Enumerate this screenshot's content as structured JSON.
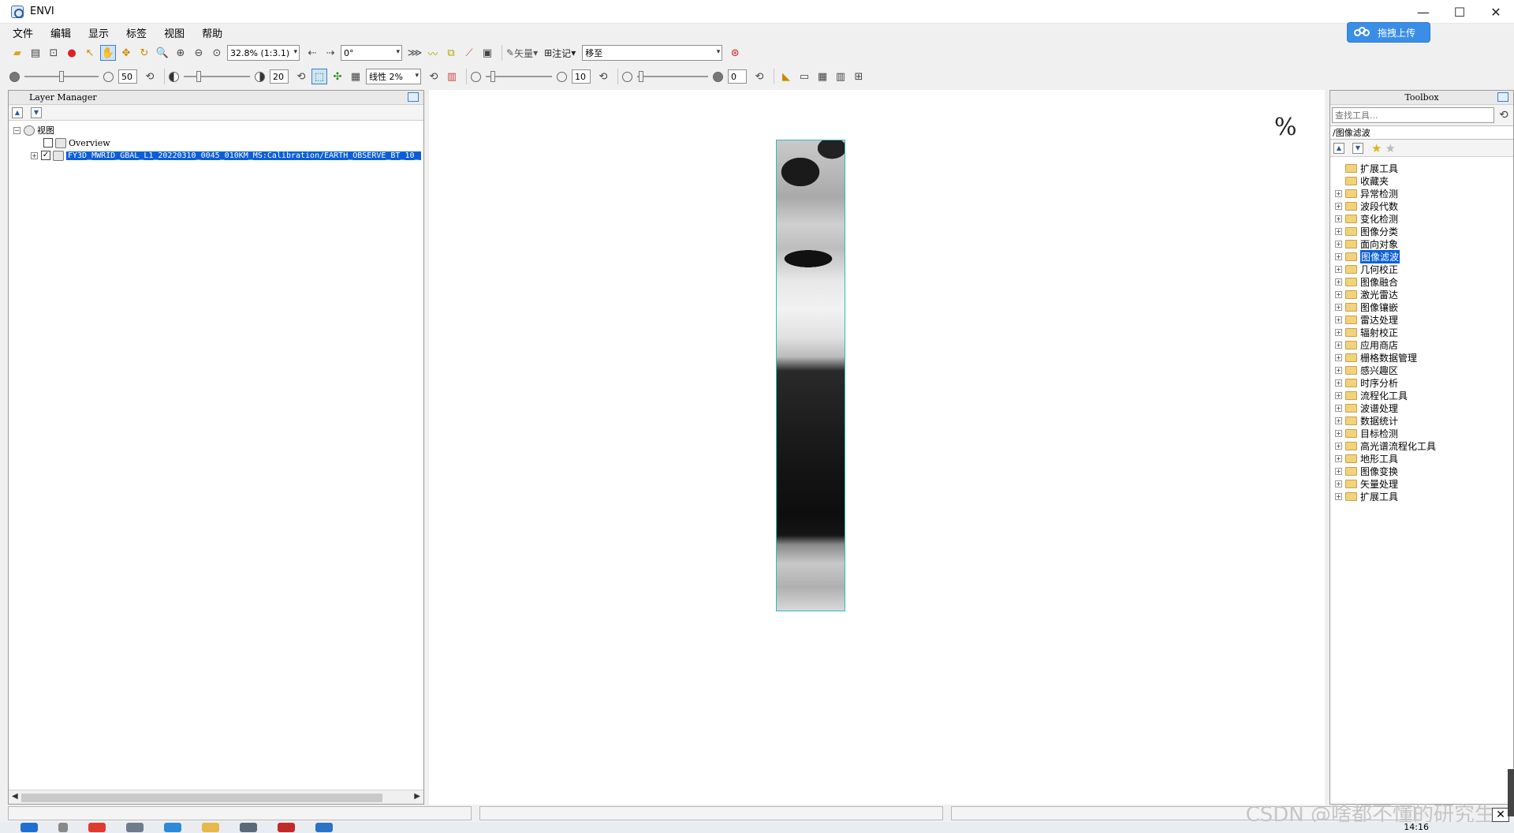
{
  "window": {
    "title": "ENVI",
    "minimize": "—",
    "maximize": "☐",
    "close": "✕"
  },
  "upload_button": {
    "label": "拖拽上传"
  },
  "menu": [
    "文件",
    "编辑",
    "显示",
    "标签",
    "视图",
    "帮助"
  ],
  "toolbar1": {
    "zoom_value": "32.8% (1:3.1)",
    "rotation_value": "0°",
    "vector_label": "矢量",
    "annotation_label": "注记",
    "goto_value": "移至"
  },
  "toolbar2": {
    "brightness_value": "50",
    "contrast_value": "20",
    "stretch_value": "线性 2%",
    "sharpen_value": "10",
    "transparency_value": "0"
  },
  "layer_manager": {
    "title": "Layer Manager",
    "root_label": "视图",
    "overview_label": "Overview",
    "layer_label": "FY3D_MWRID_GBAL_L1_20220310_0045_010KM_MS:Calibration/EARTH_OBSERVE_BT_10_",
    "overview_checked": "",
    "layer_checked": "✓"
  },
  "toolbox": {
    "title": "Toolbox",
    "search_placeholder": "查找工具...",
    "current_path": "/图像滤波",
    "items": [
      {
        "label": "扩展工具",
        "expandable": false
      },
      {
        "label": "收藏夹",
        "expandable": false
      },
      {
        "label": "异常检测",
        "expandable": true
      },
      {
        "label": "波段代数",
        "expandable": true
      },
      {
        "label": "变化检测",
        "expandable": true
      },
      {
        "label": "图像分类",
        "expandable": true
      },
      {
        "label": "面向对象",
        "expandable": true
      },
      {
        "label": "图像滤波",
        "expandable": true,
        "selected": true
      },
      {
        "label": "几何校正",
        "expandable": true
      },
      {
        "label": "图像融合",
        "expandable": true
      },
      {
        "label": "激光雷达",
        "expandable": true
      },
      {
        "label": "图像镶嵌",
        "expandable": true
      },
      {
        "label": "雷达处理",
        "expandable": true
      },
      {
        "label": "辐射校正",
        "expandable": true
      },
      {
        "label": "应用商店",
        "expandable": true
      },
      {
        "label": "栅格数据管理",
        "expandable": true
      },
      {
        "label": "感兴趣区",
        "expandable": true
      },
      {
        "label": "时序分析",
        "expandable": true
      },
      {
        "label": "流程化工具",
        "expandable": true
      },
      {
        "label": "波谱处理",
        "expandable": true
      },
      {
        "label": "数据统计",
        "expandable": true
      },
      {
        "label": "目标检测",
        "expandable": true
      },
      {
        "label": "高光谱流程化工具",
        "expandable": true
      },
      {
        "label": "地形工具",
        "expandable": true
      },
      {
        "label": "图像变换",
        "expandable": true
      },
      {
        "label": "矢量处理",
        "expandable": true
      },
      {
        "label": "扩展工具",
        "expandable": true
      }
    ]
  },
  "view": {
    "percent_symbol": "%"
  },
  "watermark": "CSDN @啥都不懂的研究生",
  "clock": "14:16",
  "colors": {
    "accent": "#0a5fd8",
    "upload_btn": "#3a8ee6",
    "raster_border": "#32b8c6"
  }
}
